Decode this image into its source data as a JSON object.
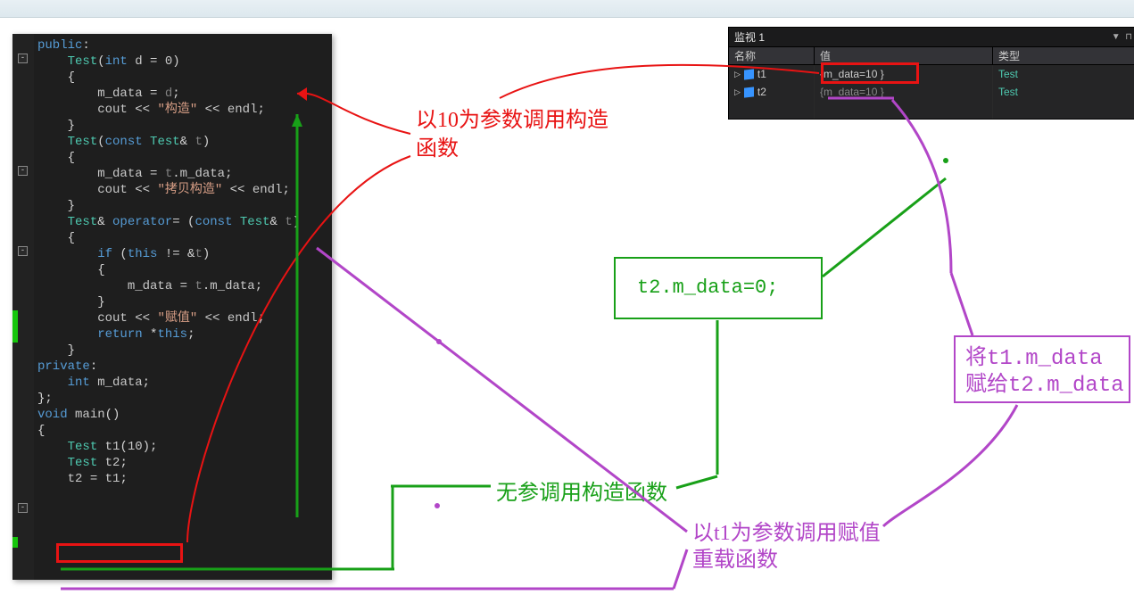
{
  "watch": {
    "title": "监视 1",
    "cols": {
      "name": "名称",
      "value": "值",
      "type": "类型"
    },
    "rows": [
      {
        "name": "t1",
        "value": "{m_data=10 }",
        "type": "Test",
        "stale": false
      },
      {
        "name": "t2",
        "value": "{m_data=10 }",
        "type": "Test",
        "stale": true
      }
    ]
  },
  "code": {
    "lines": [
      {
        "t": [
          [
            "kw",
            "public"
          ],
          [
            "op",
            ":"
          ]
        ]
      },
      {
        "indent": 1,
        "t": [
          [
            "type",
            "Test"
          ],
          [
            "op",
            "("
          ],
          [
            "kw",
            "int"
          ],
          [
            "op",
            " "
          ],
          [
            "var",
            "d"
          ],
          [
            "op",
            " = "
          ],
          [
            "var",
            "0"
          ],
          [
            "op",
            ")"
          ]
        ]
      },
      {
        "indent": 1,
        "t": [
          [
            "op",
            "{"
          ]
        ]
      },
      {
        "indent": 2,
        "t": [
          [
            "var",
            "m_data"
          ],
          [
            "op",
            " = "
          ],
          [
            "dim",
            "d"
          ],
          [
            "op",
            ";"
          ]
        ]
      },
      {
        "indent": 2,
        "t": [
          [
            "var",
            "cout"
          ],
          [
            "op",
            " << "
          ],
          [
            "str",
            "\"构造\""
          ],
          [
            "op",
            " << "
          ],
          [
            "var",
            "endl"
          ],
          [
            "op",
            ";"
          ]
        ]
      },
      {
        "indent": 1,
        "t": [
          [
            "op",
            "}"
          ]
        ]
      },
      {
        "indent": 1,
        "t": [
          [
            "type",
            "Test"
          ],
          [
            "op",
            "("
          ],
          [
            "kw",
            "const"
          ],
          [
            "op",
            " "
          ],
          [
            "type",
            "Test"
          ],
          [
            "op",
            "& "
          ],
          [
            "dim",
            "t"
          ],
          [
            "op",
            ")"
          ]
        ]
      },
      {
        "indent": 1,
        "t": [
          [
            "op",
            "{"
          ]
        ]
      },
      {
        "indent": 2,
        "t": [
          [
            "var",
            "m_data"
          ],
          [
            "op",
            " = "
          ],
          [
            "dim",
            "t"
          ],
          [
            "op",
            "."
          ],
          [
            "var",
            "m_data"
          ],
          [
            "op",
            ";"
          ]
        ]
      },
      {
        "indent": 2,
        "t": [
          [
            "var",
            "cout"
          ],
          [
            "op",
            " << "
          ],
          [
            "str",
            "\"拷贝构造\""
          ],
          [
            "op",
            " << "
          ],
          [
            "var",
            "endl"
          ],
          [
            "op",
            ";"
          ]
        ]
      },
      {
        "indent": 1,
        "t": [
          [
            "op",
            "}"
          ]
        ]
      },
      {
        "indent": 1,
        "t": [
          [
            "type",
            "Test"
          ],
          [
            "op",
            "& "
          ],
          [
            "kw",
            "operator"
          ],
          [
            "op",
            "= ("
          ],
          [
            "kw",
            "const"
          ],
          [
            "op",
            " "
          ],
          [
            "type",
            "Test"
          ],
          [
            "op",
            "& "
          ],
          [
            "dim",
            "t"
          ],
          [
            "op",
            ")"
          ]
        ]
      },
      {
        "indent": 1,
        "t": [
          [
            "op",
            "{"
          ]
        ]
      },
      {
        "indent": 2,
        "t": [
          [
            "kw",
            "if"
          ],
          [
            "op",
            " ("
          ],
          [
            "kw",
            "this"
          ],
          [
            "op",
            " != &"
          ],
          [
            "dim",
            "t"
          ],
          [
            "op",
            ")"
          ]
        ]
      },
      {
        "indent": 2,
        "t": [
          [
            "op",
            "{"
          ]
        ]
      },
      {
        "indent": 3,
        "t": [
          [
            "var",
            "m_data"
          ],
          [
            "op",
            " = "
          ],
          [
            "dim",
            "t"
          ],
          [
            "op",
            "."
          ],
          [
            "var",
            "m_data"
          ],
          [
            "op",
            ";"
          ]
        ]
      },
      {
        "indent": 2,
        "t": [
          [
            "op",
            "}"
          ]
        ]
      },
      {
        "indent": 2,
        "t": [
          [
            "var",
            "cout"
          ],
          [
            "op",
            " << "
          ],
          [
            "str",
            "\"赋值\""
          ],
          [
            "op",
            " << "
          ],
          [
            "var",
            "endl"
          ],
          [
            "op",
            ";"
          ]
        ]
      },
      {
        "indent": 2,
        "t": [
          [
            "kw",
            "return"
          ],
          [
            "op",
            " *"
          ],
          [
            "kw",
            "this"
          ],
          [
            "op",
            ";"
          ]
        ]
      },
      {
        "indent": 1,
        "t": [
          [
            "op",
            "}"
          ]
        ]
      },
      {
        "t": [
          [
            "kw",
            "private"
          ],
          [
            "op",
            ":"
          ]
        ]
      },
      {
        "indent": 1,
        "t": [
          [
            "kw",
            "int"
          ],
          [
            "op",
            " "
          ],
          [
            "var",
            "m_data"
          ],
          [
            "op",
            ";"
          ]
        ]
      },
      {
        "t": [
          [
            "op",
            "};"
          ]
        ]
      },
      {
        "t": [
          [
            "kw",
            "void"
          ],
          [
            "op",
            " "
          ],
          [
            "var",
            "main"
          ],
          [
            "op",
            "()"
          ]
        ]
      },
      {
        "t": [
          [
            "op",
            "{"
          ]
        ]
      },
      {
        "indent": 1,
        "t": [
          [
            "type",
            "Test"
          ],
          [
            "op",
            " "
          ],
          [
            "var",
            "t1"
          ],
          [
            "op",
            "("
          ],
          [
            "var",
            "10"
          ],
          [
            "op",
            ");"
          ]
        ]
      },
      {
        "indent": 1,
        "t": [
          [
            "type",
            "Test"
          ],
          [
            "op",
            " "
          ],
          [
            "var",
            "t2"
          ],
          [
            "op",
            ";"
          ]
        ]
      },
      {
        "indent": 1,
        "t": [
          [
            "var",
            "t2"
          ],
          [
            "op",
            " = "
          ],
          [
            "var",
            "t1"
          ],
          [
            "op",
            ";"
          ]
        ]
      }
    ]
  },
  "anno": {
    "red": "以10为参数调用构造\n函数",
    "greenBox": "t2.m_data=0;",
    "greenZh": "无参调用构造函数",
    "purple1": "以t1为参数调用赋值\n重载函数",
    "purple2": "将t1.m_data\n赋给t2.m_data"
  }
}
